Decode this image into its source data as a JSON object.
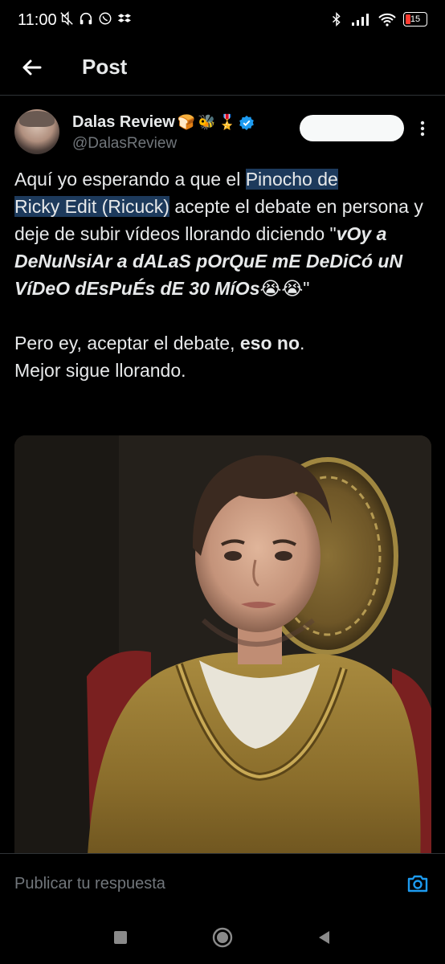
{
  "status_bar": {
    "time": "11:00",
    "battery": "15"
  },
  "header": {
    "title": "Post"
  },
  "author": {
    "name": "Dalas Review",
    "name_emojis": [
      "🍞",
      "🐝",
      "🎖️"
    ],
    "handle": "@DalasReview"
  },
  "tweet": {
    "p1_a": "Aquí yo esperando a que el ",
    "p1_hl1": "Pinocho de",
    "p1_hl2": "Ricky Edit (Ricuck)",
    "p1_b": " acepte el debate en persona y deje de subir vídeos llorando diciendo \"",
    "p1_italic": "vOy a DeNuNsiAr a dALaS pOrQuE mE DeDiCó uN VíDeO dEsPuÉs dE 30 MíOs",
    "p1_emojis": "😭😭",
    "p1_end": "\"",
    "p2_a": "Pero ey, aceptar el debate, ",
    "p2_bold": "eso no",
    "p2_b": ".",
    "p2_c": "Mejor sigue llorando."
  },
  "reply": {
    "placeholder": "Publicar tu respuesta"
  },
  "colors": {
    "background": "#000000",
    "text": "#e7e9ea",
    "secondary": "#71767b",
    "accent": "#1d9bf0",
    "highlight": "#1d3a5c"
  },
  "icons": {
    "back": "arrow-left-icon",
    "more": "more-vertical-icon",
    "verified": "verified-badge-icon",
    "camera": "camera-icon"
  }
}
